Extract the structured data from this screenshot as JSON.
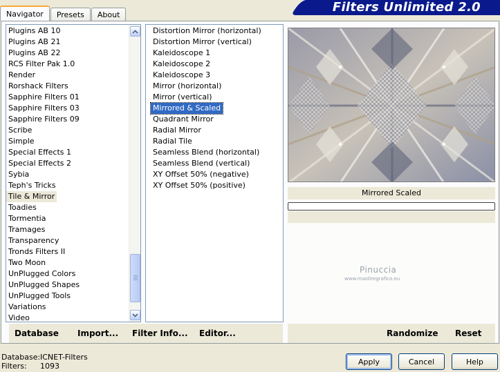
{
  "tabs": [
    {
      "label": "Navigator",
      "active": true
    },
    {
      "label": "Presets",
      "active": false
    },
    {
      "label": "About",
      "active": false
    }
  ],
  "banner": {
    "title": "Filters Unlimited 2.0"
  },
  "categories": {
    "items": [
      "Plugins AB 10",
      "Plugins AB 21",
      "Plugins AB 22",
      "RCS Filter Pak 1.0",
      "Render",
      "Rorshack Filters",
      "Sapphire Filters 01",
      "Sapphire Filters 03",
      "Sapphire Filters 09",
      "Scribe",
      "Simple",
      "Special Effects 1",
      "Special Effects 2",
      "Sybia",
      "Teph's Tricks",
      "Tile & Mirror",
      "Toadies",
      "Tormentia",
      "Tramages",
      "Transparency",
      "Tronds Filters II",
      "Two Moon",
      "UnPlugged Colors",
      "UnPlugged Shapes",
      "UnPlugged Tools",
      "Variations",
      "Video"
    ],
    "selected_index": 15
  },
  "filters": {
    "items": [
      "Distortion Mirror (horizontal)",
      "Distortion Mirror (vertical)",
      "Kaleidoscope 1",
      "Kaleidoscope 2",
      "Kaleidoscope 3",
      "Mirror (horizontal)",
      "Mirror (vertical)",
      "Mirrored & Scaled",
      "Quadrant Mirror",
      "Radial Mirror",
      "Radial Tile",
      "Seamless Blend (horizontal)",
      "Seamless Blend (vertical)",
      "XY Offset 50% (negative)",
      "XY Offset 50% (positive)"
    ],
    "selected_index": 7
  },
  "preview": {
    "filter_name": "Mirrored  Scaled",
    "progress": 0
  },
  "watermark": {
    "name": "Pinuccia",
    "url": "www.maidiregrafico.eu"
  },
  "toolbar": {
    "database": "Database",
    "import": "Import...",
    "filter_info": "Filter Info...",
    "editor": "Editor...",
    "randomize": "Randomize",
    "reset": "Reset"
  },
  "status": {
    "database_label": "Database:",
    "database_value": "ICNET-Filters",
    "filters_label": "Filters:",
    "filters_value": "1093"
  },
  "buttons": {
    "apply": "Apply",
    "cancel": "Cancel",
    "help": "Help"
  },
  "colors": {
    "selection": "#316ac5",
    "banner": "#0a1a8c",
    "window": "#ece9d8"
  },
  "icons": {
    "scroll_up": "chevron-up-icon",
    "scroll_down": "chevron-down-icon"
  }
}
